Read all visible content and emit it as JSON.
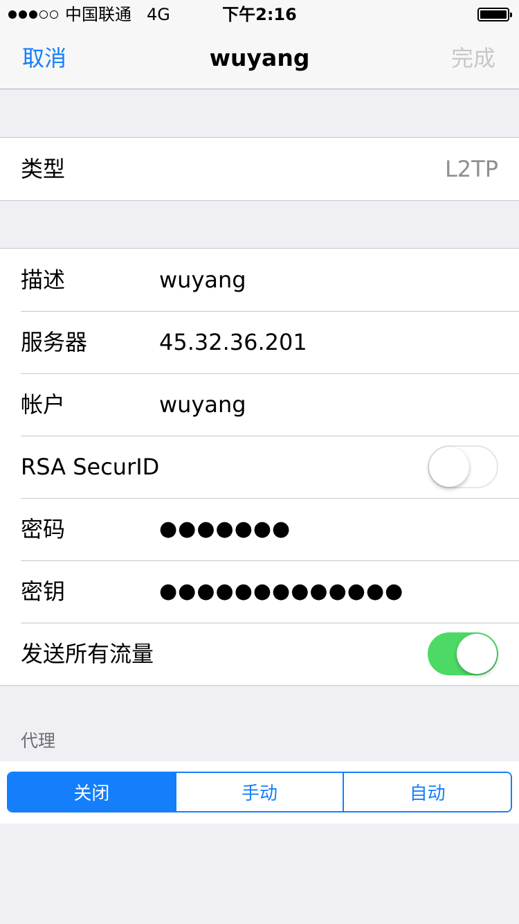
{
  "status_bar": {
    "carrier": "中国联通",
    "network": "4G",
    "time": "下午2:16",
    "signal_bars_filled": 3,
    "signal_bars_total": 5
  },
  "nav": {
    "cancel_label": "取消",
    "title": "wuyang",
    "done_label": "完成"
  },
  "type_row": {
    "label": "类型",
    "value": "L2TP"
  },
  "fields": {
    "description": {
      "label": "描述",
      "value": "wuyang"
    },
    "server": {
      "label": "服务器",
      "value": "45.32.36.201"
    },
    "account": {
      "label": "帐户",
      "value": "wuyang"
    },
    "rsa": {
      "label": "RSA SecurID",
      "enabled": false
    },
    "password": {
      "label": "密码",
      "value": "●●●●●●●"
    },
    "secret": {
      "label": "密钥",
      "value": "●●●●●●●●●●●●●"
    },
    "send_all_traffic": {
      "label": "发送所有流量",
      "enabled": true
    }
  },
  "proxy": {
    "header": "代理",
    "options": [
      "关闭",
      "手动",
      "自动"
    ],
    "selected": "关闭"
  },
  "colors": {
    "accent": "#157efb",
    "toggle_on": "#4cd964",
    "background": "#efeff4",
    "disabled": "#c7c7cc"
  }
}
